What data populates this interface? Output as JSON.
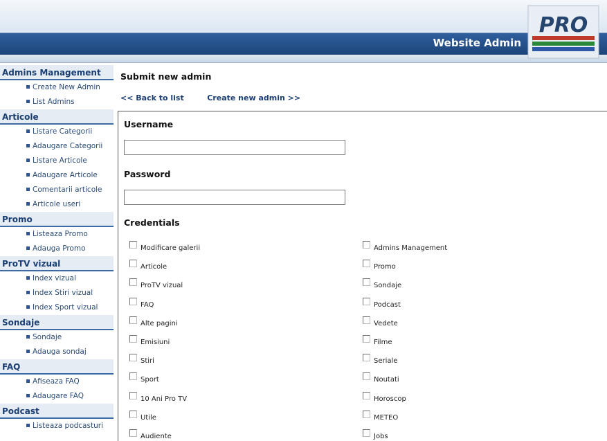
{
  "header": {
    "site_title": "Website Admin",
    "logo_text": "PRO"
  },
  "sidebar": [
    {
      "label": "Admins Management",
      "items": [
        "Create New Admin",
        "List Admins"
      ]
    },
    {
      "label": "Articole",
      "items": [
        "Listare Categorii",
        "Adaugare Categorii",
        "Listare Articole",
        "Adaugare Articole",
        "Comentarii articole",
        "Articole useri"
      ]
    },
    {
      "label": "Promo",
      "items": [
        "Listeaza Promo",
        "Adauga Promo"
      ]
    },
    {
      "label": "ProTV vizual",
      "items": [
        "Index vizual",
        "Index Stiri vizual",
        "Index Sport vizual"
      ]
    },
    {
      "label": "Sondaje",
      "items": [
        "Sondaje",
        "Adauga sondaj"
      ]
    },
    {
      "label": "FAQ",
      "items": [
        "Afiseaza FAQ",
        "Adaugare FAQ"
      ]
    },
    {
      "label": "Podcast",
      "items": [
        "Listeaza podcasturi"
      ]
    }
  ],
  "main": {
    "title": "Submit new admin",
    "back_link": "<< Back to list",
    "create_link": "Create new admin >>",
    "username_label": "Username",
    "username_value": "",
    "password_label": "Password",
    "password_value": "",
    "credentials_label": "Credentials",
    "credentials_left": [
      "Modificare galerii",
      "Articole",
      "ProTV vizual",
      "FAQ",
      "Alte pagini",
      "Emisiuni",
      "Stiri",
      "Sport",
      "10 Ani Pro TV",
      "Utile",
      "Audiente"
    ],
    "credentials_right": [
      "Admins Management",
      "Promo",
      "Sondaje",
      "Podcast",
      "Vedete",
      "Filme",
      "Seriale",
      "Noutati",
      "Horoscop",
      "METEO",
      "Jobs"
    ]
  },
  "colors": {
    "header_blue": "#1c4478",
    "sidebar_border": "#3c6aa5",
    "link": "#1c3f73"
  }
}
